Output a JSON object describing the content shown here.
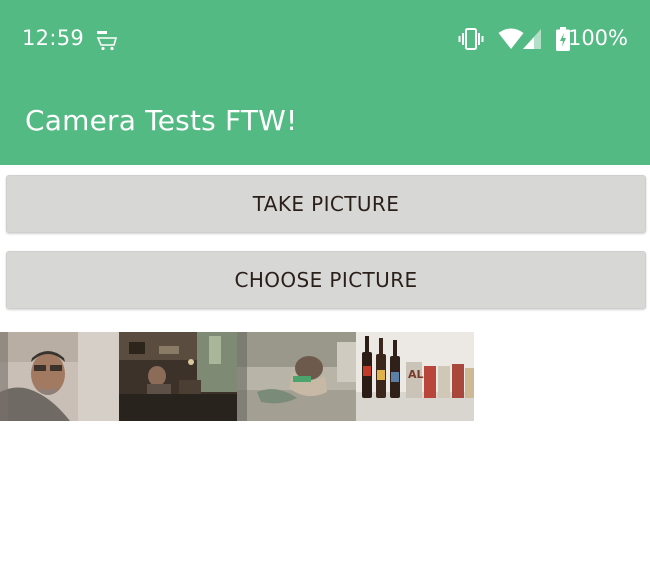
{
  "status_bar": {
    "time": "12:59",
    "battery_percent": "100%",
    "icons": [
      "shopping-cart-notification-icon",
      "vibrate-icon",
      "wifi-icon",
      "cell-signal-icon",
      "battery-charging-icon"
    ]
  },
  "app_bar": {
    "title": "Camera Tests FTW!",
    "color": "#54ba83"
  },
  "buttons": {
    "take_picture": "TAKE PICTURE",
    "choose_picture": "CHOOSE PICTURE"
  },
  "gallery": {
    "thumbnails": [
      {
        "name": "photo-thumbnail-selfie"
      },
      {
        "name": "photo-thumbnail-room"
      },
      {
        "name": "photo-thumbnail-person-sleeping"
      },
      {
        "name": "photo-thumbnail-beer-bottles"
      }
    ]
  }
}
